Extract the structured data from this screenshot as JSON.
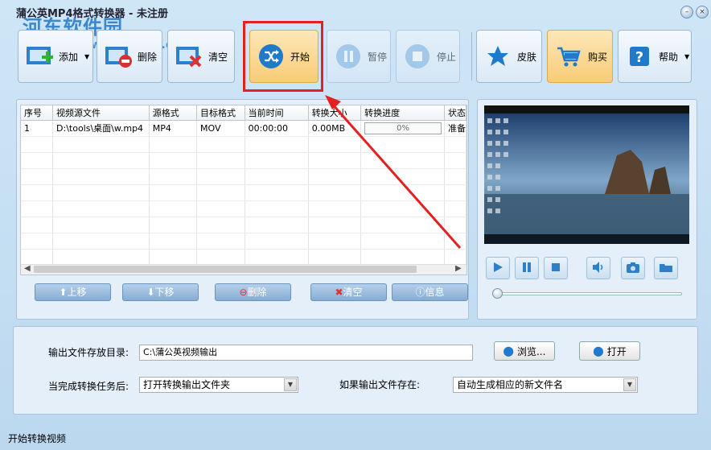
{
  "window": {
    "title": "蒲公英MP4格式转换器 - 未注册",
    "watermark": "河东软件园",
    "watermark_url": "www.pc0359.cn"
  },
  "toolbar": {
    "add": "添加",
    "delete": "删除",
    "clear": "清空",
    "start": "开始",
    "pause": "暂停",
    "stop": "停止",
    "skin": "皮肤",
    "buy": "购买",
    "help": "帮助"
  },
  "table": {
    "headers": [
      "序号",
      "视频源文件",
      "源格式",
      "目标格式",
      "当前时间",
      "转换大小",
      "转换进度",
      "状态"
    ],
    "rows": [
      {
        "index": "1",
        "source": "D:\\tools\\桌面\\w.mp4",
        "src_format": "MP4",
        "dst_format": "MOV",
        "time": "00:00:00",
        "size": "0.00MB",
        "progress": "0%",
        "status": "准备"
      }
    ]
  },
  "list_buttons": {
    "up": "上移",
    "down": "下移",
    "delete": "删除",
    "clear": "清空",
    "info": "信息"
  },
  "preview": {
    "position": 0
  },
  "settings": {
    "output_dir_label": "输出文件存放目录:",
    "output_dir_value": "C:\\蒲公英视频输出",
    "browse": "浏览...",
    "open": "打开",
    "on_complete_label": "当完成转换任务后:",
    "on_complete_value": "打开转换输出文件夹",
    "if_exists_label": "如果输出文件存在:",
    "if_exists_value": "自动生成相应的新文件名"
  },
  "status": "开始转换视频",
  "colors": {
    "accent": "#f8cc78",
    "annotation": "#e42020",
    "window_bg": "#cfe6f7"
  }
}
